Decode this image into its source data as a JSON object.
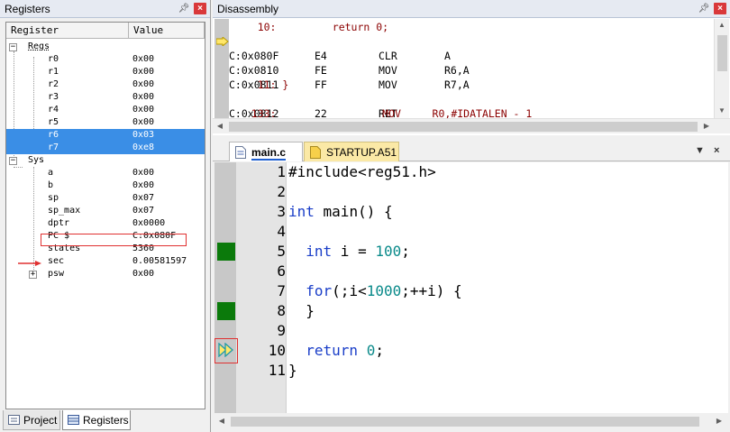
{
  "registers": {
    "title": "Registers",
    "columns": [
      "Register",
      "Value"
    ],
    "groups": [
      {
        "name": "Regs",
        "items": [
          {
            "name": "r0",
            "value": "0x00"
          },
          {
            "name": "r1",
            "value": "0x00"
          },
          {
            "name": "r2",
            "value": "0x00"
          },
          {
            "name": "r3",
            "value": "0x00"
          },
          {
            "name": "r4",
            "value": "0x00"
          },
          {
            "name": "r5",
            "value": "0x00"
          },
          {
            "name": "r6",
            "value": "0x03"
          },
          {
            "name": "r7",
            "value": "0xe8"
          }
        ]
      },
      {
        "name": "Sys",
        "items": [
          {
            "name": "a",
            "value": "0x00"
          },
          {
            "name": "b",
            "value": "0x00"
          },
          {
            "name": "sp",
            "value": "0x07"
          },
          {
            "name": "sp_max",
            "value": "0x07"
          },
          {
            "name": "dptr",
            "value": "0x0000"
          },
          {
            "name": "PC  $",
            "value": "C:0x080F"
          },
          {
            "name": "states",
            "value": "5360"
          },
          {
            "name": "sec",
            "value": "0.00581597"
          },
          {
            "name": "psw",
            "value": "0x00"
          }
        ]
      }
    ],
    "bottom_tabs": [
      "Project",
      "Registers"
    ]
  },
  "disassembly": {
    "title": "Disassembly",
    "lines": [
      {
        "kind": "src",
        "text": "    10:         return 0;"
      },
      {
        "kind": "asm",
        "addr": "C:0x080F",
        "op": "E4",
        "mnem": "CLR",
        "args": "A",
        "current": true
      },
      {
        "kind": "asm",
        "addr": "C:0x0810",
        "op": "FE",
        "mnem": "MOV",
        "args": "R6,A"
      },
      {
        "kind": "asm",
        "addr": "C:0x0811",
        "op": "FF",
        "mnem": "MOV",
        "args": "R7,A"
      },
      {
        "kind": "src",
        "text": "    11: }"
      },
      {
        "kind": "asm",
        "addr": "C:0x0812",
        "op": "22",
        "mnem": "RET",
        "args": ""
      },
      {
        "kind": "src",
        "text": "   133:                 MOV     R0,#IDATALEN - 1"
      }
    ]
  },
  "editor": {
    "tabs": [
      "main.c",
      "STARTUP.A51"
    ],
    "lines": [
      {
        "n": "1",
        "code": "#include<reg51.h>"
      },
      {
        "n": "2",
        "code": ""
      },
      {
        "n": "3",
        "code": "int main() {"
      },
      {
        "n": "4",
        "code": ""
      },
      {
        "n": "5",
        "code": "  int i = 100;"
      },
      {
        "n": "6",
        "code": ""
      },
      {
        "n": "7",
        "code": "  for(;i<1000;++i) {"
      },
      {
        "n": "8",
        "code": "  }"
      },
      {
        "n": "9",
        "code": ""
      },
      {
        "n": "10",
        "code": "  return 0;"
      },
      {
        "n": "11",
        "code": "}"
      }
    ],
    "executed_lines": [
      "5",
      "8"
    ],
    "current_line": "10"
  },
  "colors": {
    "selection": "#3a8ee6",
    "exec_mark": "#0b7a0b",
    "annotation": "#e03030",
    "keyword": "#1a3ec8",
    "number": "#0a8a8a",
    "preprocessor": "#1a8a1a"
  },
  "icons": [
    "pin-icon",
    "close-icon",
    "current-pc-arrow-icon",
    "file-icon",
    "project-icon",
    "registers-icon",
    "dropdown-icon"
  ]
}
